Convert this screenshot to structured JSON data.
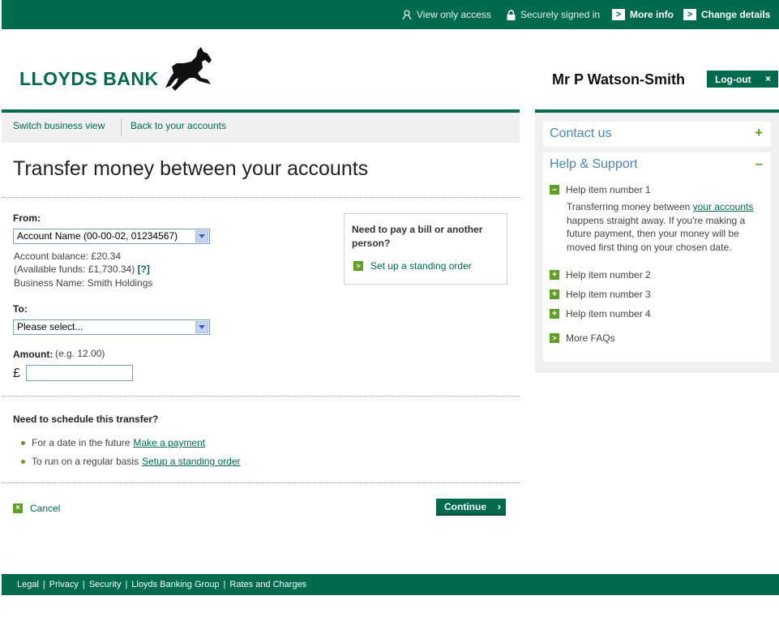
{
  "topbar": {
    "view_only": "View only access",
    "signed_in": "Securely signed in",
    "more_info": "More info",
    "change_details": "Change details",
    "arrow_glyph": ">"
  },
  "header": {
    "brand": "LLOYDS BANK",
    "user_name": "Mr P Watson-Smith",
    "logout": "Log-out",
    "logout_x": "×"
  },
  "subnav": {
    "switch_view": "Switch business view",
    "back": "Back to your accounts"
  },
  "page": {
    "title": "Transfer money between your accounts"
  },
  "form": {
    "from_label": "From:",
    "from_value": "Account Name (00-00-02, 01234567)",
    "balance": "Account balance: £20.34",
    "available": "(Available funds: £1,730.34)",
    "help_q": "[?]",
    "business_name": "Business Name: Smith Holdings",
    "to_label": "To:",
    "to_value": "Please select...",
    "amount_label": "Amount:",
    "amount_hint": "(e.g. 12.00)",
    "currency": "£",
    "amount_value": ""
  },
  "callout": {
    "question": "Need to pay a bill or another person?",
    "link": "Set up a standing order",
    "arrow_glyph": ">"
  },
  "schedule": {
    "title": "Need to schedule this transfer?",
    "items": [
      {
        "text": "For a date in the future",
        "link": "Make a payment"
      },
      {
        "text": "To run on a regular basis",
        "link": "Setup a standing order"
      }
    ]
  },
  "actions": {
    "cancel": "Cancel",
    "cancel_glyph": "×",
    "continue": "Continue",
    "continue_glyph": "›"
  },
  "sidebar": {
    "contact": "Contact us",
    "contact_toggle": "+",
    "help_title": "Help & Support",
    "help_toggle": "–",
    "items": [
      {
        "label": "Help item number 1",
        "glyph": "–"
      },
      {
        "label": "Help item number 2",
        "glyph": "+"
      },
      {
        "label": "Help item number 3",
        "glyph": "+"
      },
      {
        "label": "Help item number 4",
        "glyph": "+"
      }
    ],
    "help_text_before": "Transferring money between ",
    "help_text_link": "your accounts",
    "help_text_after": " happens straight away. If you're making a future payment, then your money will be moved first thing on your chosen date.",
    "more_faqs": "More FAQs",
    "more_glyph": ">"
  },
  "footer": {
    "links": [
      "Legal",
      "Privacy",
      "Security",
      "Lloyds Banking Group",
      "Rates and Charges"
    ],
    "separator": "|"
  },
  "colors": {
    "brand_green": "#006a4d",
    "accent_green": "#5fa022",
    "link_blue": "#4a86b8"
  }
}
